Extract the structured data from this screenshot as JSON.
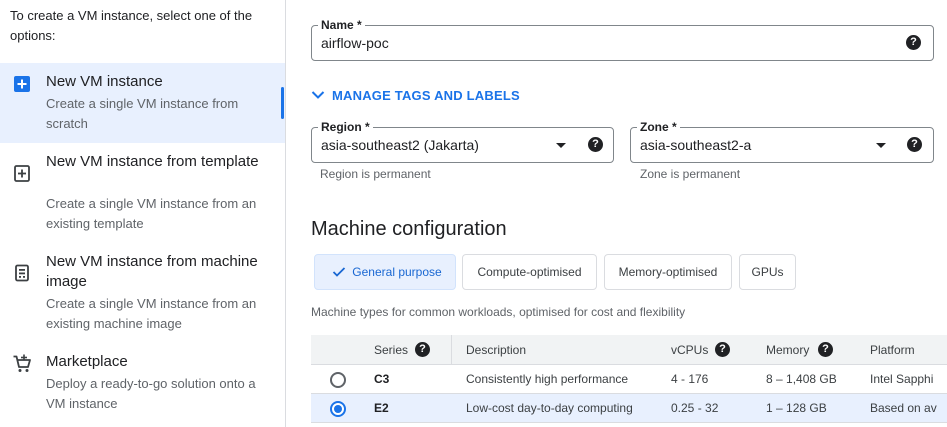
{
  "sidebar": {
    "intro": "To create a VM instance, select one of the options:",
    "options": [
      {
        "title": "New VM instance",
        "desc": "Create a single VM instance from scratch",
        "icon": "add-box-icon",
        "selected": true
      },
      {
        "title": "New VM instance from template",
        "desc": "Create a single VM instance from an existing template",
        "icon": "template-add-icon",
        "selected": false
      },
      {
        "title": "New VM instance from machine image",
        "desc": "Create a single VM instance from an existing machine image",
        "icon": "machine-image-icon",
        "selected": false
      },
      {
        "title": "Marketplace",
        "desc": "Deploy a ready-to-go solution onto a VM instance",
        "icon": "cart-icon",
        "selected": false
      }
    ]
  },
  "form": {
    "name": {
      "label": "Name *",
      "value": "airflow-poc"
    },
    "manage_tags": "MANAGE TAGS AND LABELS",
    "region": {
      "label": "Region *",
      "value": "asia-southeast2 (Jakarta)",
      "hint": "Region is permanent"
    },
    "zone": {
      "label": "Zone *",
      "value": "asia-southeast2-a",
      "hint": "Zone is permanent"
    },
    "help_glyph": "?"
  },
  "machine": {
    "heading": "Machine configuration",
    "tabs": [
      "General purpose",
      "Compute-optimised",
      "Memory-optimised",
      "GPUs"
    ],
    "selected_tab": 0,
    "subtitle": "Machine types for common workloads, optimised for cost and flexibility",
    "columns": {
      "series": "Series",
      "description": "Description",
      "vcpus": "vCPUs",
      "memory": "Memory",
      "platform": "Platform"
    },
    "rows": [
      {
        "series": "C3",
        "description": "Consistently high performance",
        "vcpus": "4 - 176",
        "memory": "8 – 1,408 GB",
        "platform": "Intel Sapphi",
        "selected": false
      },
      {
        "series": "E2",
        "description": "Low-cost day-to-day computing",
        "vcpus": "0.25 - 32",
        "memory": "1 – 128 GB",
        "platform": "Based on av",
        "selected": true
      }
    ]
  },
  "colors": {
    "accent": "#1a73e8",
    "selected_bg": "#e8f0fe",
    "border": "#dadce0"
  }
}
